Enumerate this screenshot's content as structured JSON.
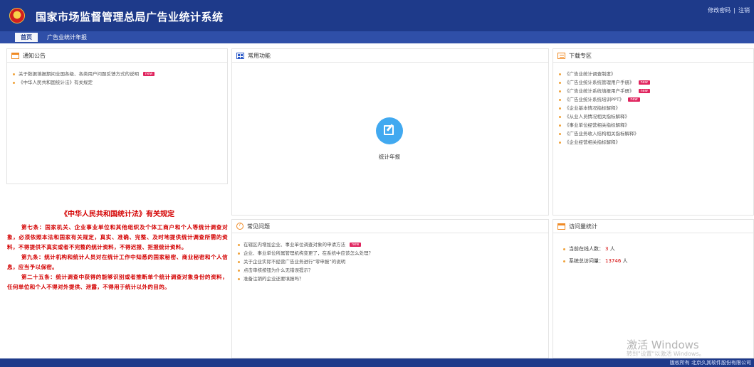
{
  "header": {
    "title": "国家市场监督管理总局广告业统计系统",
    "links": {
      "change_password": "修改密码",
      "separator": "|",
      "logout": "注销"
    }
  },
  "nav": {
    "tabs": [
      {
        "label": "首页"
      },
      {
        "label": "广告业统计年报"
      }
    ]
  },
  "notice": {
    "title": "通知公告",
    "items": [
      {
        "text": "关于数据填报期间全国各级、各类用户问题反馈方式的说明",
        "badge": "new"
      },
      {
        "text": "《中华人民共和国统计法》有关规定"
      }
    ]
  },
  "law": {
    "title": "《中华人民共和国统计法》有关规定",
    "paragraphs": [
      "第七条：国家机关、企业事业单位和其他组织及个体工商户和个人等统计调查对象，必须依照本法和国家有关规定，真实、准确、完整、及时地提供统计调查所需的资料，不得提供不真实或者不完整的统计资料，不得迟报、拒报统计资料。",
      "第九条：统计机构和统计人员对在统计工作中知悉的国家秘密、商业秘密和个人信息，应当予以保密。",
      "第二十五条：统计调查中获得的能够识别或者推断单个统计调查对象身份的资料，任何单位和个人不得对外提供、泄露，不得用于统计以外的目的。"
    ]
  },
  "functions": {
    "title": "常用功能",
    "button_label": "统计年报"
  },
  "downloads": {
    "title": "下载专区",
    "items": [
      {
        "text": "《广告业统计调查制度》"
      },
      {
        "text": "《广告业统计系统管理用户手册》",
        "badge": "new"
      },
      {
        "text": "《广告业统计系统填报用户手册》",
        "badge": "new"
      },
      {
        "text": "《广告业统计系统培训PPT》",
        "badge": "new"
      },
      {
        "text": "《企业基本情况指标解释》"
      },
      {
        "text": "《从业人员情况相关指标解释》"
      },
      {
        "text": "《事业单位经营相关指标解释》"
      },
      {
        "text": "《广告业务收入结构相关指标解释》"
      },
      {
        "text": "《企业经营相关指标解释》"
      }
    ]
  },
  "faq": {
    "title": "常见问题",
    "items": [
      {
        "text": "在辖区内增加企业、事业单位调查对象的申请方法",
        "badge": "new"
      },
      {
        "text": "企业、事业单位所属管理机构变更了，在系统中应该怎么处理？"
      },
      {
        "text": "关于企业实际不经营广告业务进行“零申报”的说明"
      },
      {
        "text": "点击审核按钮为什么无错误提示？"
      },
      {
        "text": "准备注销的企业还要填报吗？"
      }
    ]
  },
  "visits": {
    "title": "访问量统计",
    "online_label": "当前在线人数：",
    "online_value": "3",
    "online_unit": "人",
    "total_label": "系统总访问量：",
    "total_value": "13746",
    "total_unit": "人"
  },
  "watermark": {
    "line1": "激活 Windows",
    "line2": "转到\"设置\"以激活 Windows。"
  },
  "footer": {
    "copyright": "版权所有 北京久其软件股份有限公司"
  },
  "colors": {
    "header": "#1e3a8a",
    "nav": "#2f4fa8",
    "accent_orange": "#f08a24",
    "law_red": "#d40000",
    "badge": "#e0245e",
    "button_blue": "#41a9f0"
  }
}
